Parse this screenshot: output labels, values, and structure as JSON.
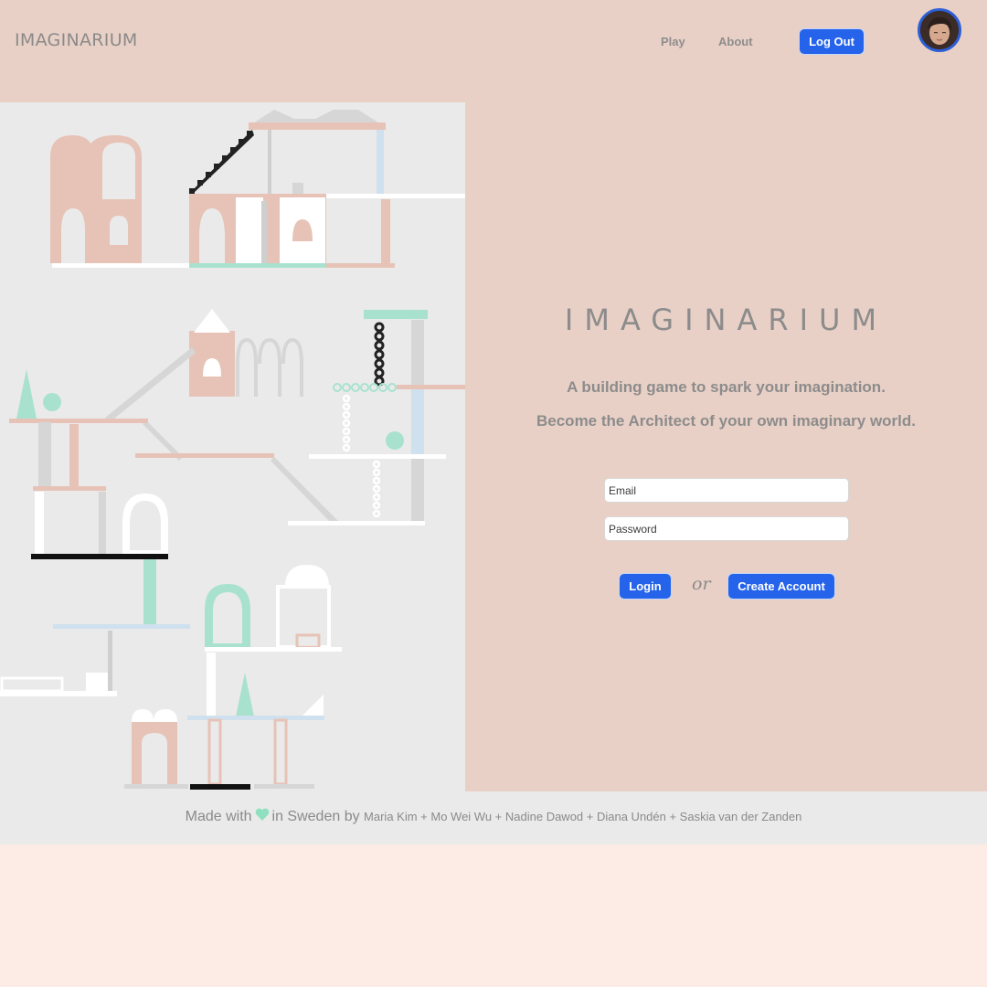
{
  "header": {
    "brand": "IMAGINARIUM",
    "nav": {
      "play": "Play",
      "about": "About"
    },
    "logout_label": "Log Out"
  },
  "hero": {
    "title": "IMAGINARIUM",
    "tagline_1": "A building game to spark your imagination.",
    "tagline_2": "Become the Architect of your own imaginary world."
  },
  "form": {
    "email_placeholder": "Email",
    "password_placeholder": "Password",
    "login_label": "Login",
    "or_label": "or",
    "create_label": "Create Account"
  },
  "footer": {
    "made_with": "Made with",
    "in_sweden_by": "in Sweden by",
    "credits": "Maria Kim + Mo Wei Wu + Nadine Dawod + Diana Undén + Saskia van der Zanden"
  },
  "colors": {
    "accent": "#2563eb",
    "header_bg": "#e9d0c6",
    "panel_bg": "#ebeaea",
    "page_bg": "#fdece6",
    "heart": "#8fe0c0",
    "text_muted": "#8c8c8c"
  },
  "icons": {
    "heart": "heart-icon",
    "avatar": "user-avatar"
  }
}
